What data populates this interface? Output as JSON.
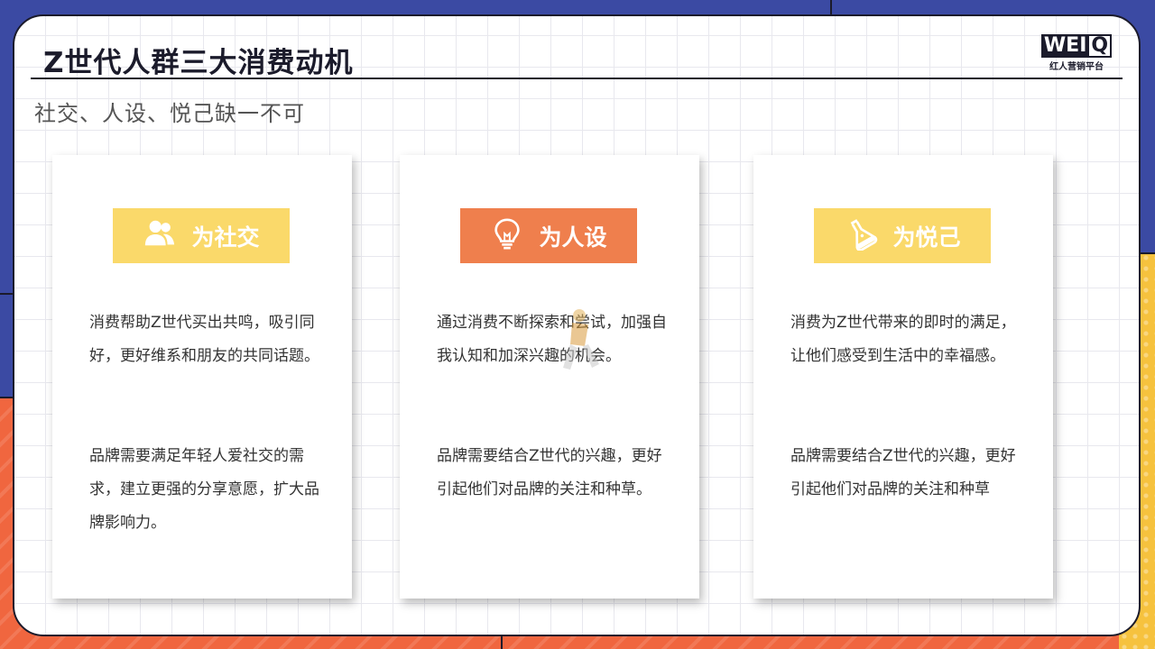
{
  "header": {
    "title": "Z世代人群三大消费动机",
    "subtitle": "社交、人设、悦己缺一不可"
  },
  "logo": {
    "mark_box": "WEI",
    "mark_q": "Q",
    "sub": "红人营销平台"
  },
  "colors": {
    "frame_blue": "#3b4aa3",
    "accent_red": "#f0663f",
    "accent_yellow": "#f6c23e",
    "badge_yellow": "#fad96a",
    "badge_orange": "#ef7f4d"
  },
  "cards": [
    {
      "badge": "为社交",
      "icon": "people-icon",
      "badge_color": "#fad96a",
      "p1": "消费帮助Z世代买出共鸣，吸引同好，更好维系和朋友的共同话题。",
      "p2": "品牌需要满足年轻人爱社交的需求，建立更强的分享意愿，扩大品牌影响力。"
    },
    {
      "badge": "为人设",
      "icon": "lightbulb-icon",
      "badge_color": "#ef7f4d",
      "p1": "通过消费不断探索和尝试，加强自我认知和加深兴趣的机会。",
      "p2": "品牌需要结合Z世代的兴趣，更好引起他们对品牌的关注和种草。"
    },
    {
      "badge": "为悦己",
      "icon": "flask-icon",
      "badge_color": "#fad96a",
      "p1": "消费为Z世代带来的即时的满足，让他们感受到生活中的幸福感。",
      "p2": "品牌需要结合Z世代的兴趣，更好引起他们对品牌的关注和种草"
    }
  ]
}
